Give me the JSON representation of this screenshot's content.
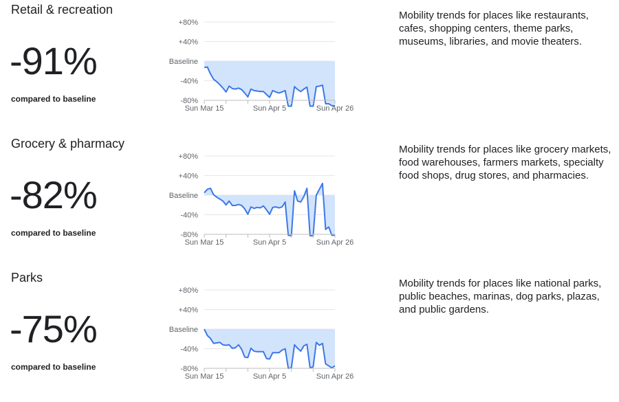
{
  "colors": {
    "line": "#3b78e7",
    "fill": "#d2e3fc",
    "grid": "#e6e6e6"
  },
  "sections": [
    {
      "title": "Retail & recreation",
      "value": "-91%",
      "compared": "compared to baseline",
      "description": "Mobility trends for places like restaurants, cafes, shopping centers, theme parks, museums, libraries, and movie theaters."
    },
    {
      "title": "Grocery & pharmacy",
      "value": "-82%",
      "compared": "compared to baseline",
      "description": "Mobility trends for places like grocery markets, food warehouses, farmers markets, specialty food shops, drug stores, and pharmacies."
    },
    {
      "title": "Parks",
      "value": "-75%",
      "compared": "compared to baseline",
      "description": "Mobility trends for places like national parks, public beaches, marinas, dog parks, plazas, and public gardens."
    }
  ],
  "chart_data": [
    {
      "type": "area",
      "title": "Retail & recreation",
      "x_start": "2020-03-15",
      "x_end": "2020-04-26",
      "x_step": "1 day",
      "y_ticks": [
        "+80%",
        "+40%",
        "Baseline",
        "-40%",
        "-80%"
      ],
      "x_ticks": [
        "Sun Mar 15",
        "Sun Apr 5",
        "Sun Apr 26"
      ],
      "ylim": [
        -80,
        80
      ],
      "grid": true,
      "values": [
        -13,
        -12,
        -26,
        -37,
        -42,
        -48,
        -55,
        -63,
        -51,
        -56,
        -57,
        -55,
        -58,
        -65,
        -73,
        -57,
        -60,
        -61,
        -62,
        -62,
        -68,
        -74,
        -60,
        -63,
        -65,
        -63,
        -60,
        -92,
        -92,
        -52,
        -58,
        -62,
        -57,
        -53,
        -92,
        -92,
        -52,
        -51,
        -49,
        -87,
        -87,
        -91,
        -91
      ]
    },
    {
      "type": "area",
      "title": "Grocery & pharmacy",
      "x_start": "2020-03-15",
      "x_end": "2020-04-26",
      "x_step": "1 day",
      "y_ticks": [
        "+80%",
        "+40%",
        "Baseline",
        "-40%",
        "-80%"
      ],
      "x_ticks": [
        "Sun Mar 15",
        "Sun Apr 5",
        "Sun Apr 26"
      ],
      "ylim": [
        -80,
        80
      ],
      "grid": true,
      "values": [
        5,
        12,
        14,
        1,
        -4,
        -8,
        -12,
        -20,
        -12,
        -21,
        -21,
        -19,
        -21,
        -28,
        -39,
        -24,
        -27,
        -25,
        -26,
        -22,
        -30,
        -39,
        -25,
        -24,
        -26,
        -24,
        -14,
        -82,
        -83,
        9,
        -12,
        -14,
        -3,
        14,
        -83,
        -83,
        0,
        12,
        24,
        -70,
        -65,
        -82,
        -82
      ]
    },
    {
      "type": "area",
      "title": "Parks",
      "x_start": "2020-03-15",
      "x_end": "2020-04-26",
      "x_step": "1 day",
      "y_ticks": [
        "+80%",
        "+40%",
        "Baseline",
        "-40%",
        "-80%"
      ],
      "x_ticks": [
        "Sun Mar 15",
        "Sun Apr 5",
        "Sun Apr 26"
      ],
      "ylim": [
        -80,
        80
      ],
      "grid": true,
      "values": [
        0,
        -13,
        -19,
        -29,
        -28,
        -27,
        -32,
        -33,
        -32,
        -39,
        -38,
        -32,
        -41,
        -57,
        -58,
        -39,
        -45,
        -46,
        -46,
        -46,
        -60,
        -61,
        -48,
        -48,
        -48,
        -43,
        -40,
        -80,
        -79,
        -32,
        -39,
        -45,
        -34,
        -31,
        -79,
        -77,
        -27,
        -33,
        -29,
        -71,
        -75,
        -79,
        -75
      ]
    }
  ]
}
